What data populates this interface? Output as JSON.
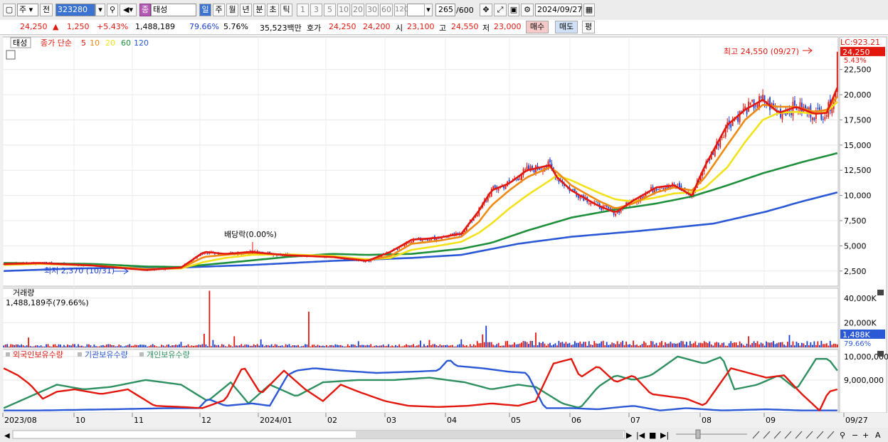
{
  "toolbar": {
    "type_stock": "주",
    "type_prev": "전",
    "code": "323280",
    "name_tag": "종",
    "name": "태성",
    "periods": [
      "일",
      "주",
      "월",
      "년",
      "분",
      "초",
      "틱"
    ],
    "minutes": [
      "1",
      "3",
      "5",
      "10",
      "20",
      "30",
      "60",
      "120"
    ],
    "count": "265",
    "count_total": "/600",
    "date": "2024/09/27"
  },
  "quote": {
    "price": "24,250",
    "arrow": "▲",
    "change": "1,250",
    "change_pct": "+5.43%",
    "volume": "1,488,189",
    "vol_ratio": "79.66%",
    "turnover": "5.76%",
    "amount": "35,523백만",
    "bid_label": "호가",
    "ask": "24,250",
    "bid": "24,200",
    "open_label": "시",
    "open": "23,100",
    "high_label": "고",
    "high": "24,550",
    "low_label": "저",
    "low": "23,000",
    "buy": "매수",
    "sell": "매도",
    "avg": "평"
  },
  "colors": {
    "up": "#e2180f",
    "down": "#1a3fd0",
    "ma5": "#e2180f",
    "ma10": "#ef8a12",
    "ma20": "#f2e21a",
    "ma60": "#1e8f3a",
    "ma120": "#2b59d6",
    "foreign": "#e2180f",
    "institution": "#2b59d6",
    "individual": "#2e9060"
  },
  "chart_data": [
    {
      "type": "candlestick",
      "panel": "price",
      "stock_label": "태성",
      "legend": {
        "ma_label": "종가 단순",
        "periods": [
          "5",
          "10",
          "20",
          "60",
          "120"
        ]
      },
      "y_ticks": [
        "2,500",
        "5,000",
        "7,500",
        "10,000",
        "12,500",
        "15,000",
        "17,500",
        "20,000",
        "22,500"
      ],
      "x_ticks": [
        "2023/08",
        "10",
        "11",
        "12",
        "2024/01",
        "02",
        "03",
        "04",
        "05",
        "06",
        "07",
        "08",
        "09",
        "09/27"
      ],
      "ylim": [
        1000,
        25300
      ],
      "current": "24,250",
      "current_pct": "5.43%",
      "lc": "LC:923.21",
      "annotations": {
        "high": "최고 24,550 (09/27)",
        "low": "최저 2,370 (10/31)",
        "dividend": "배당락(0.00%)"
      },
      "ma_knots": {
        "ma5": [
          [
            0,
            3200
          ],
          [
            20,
            3300
          ],
          [
            50,
            3050
          ],
          [
            80,
            2600
          ],
          [
            100,
            2850
          ],
          [
            113,
            4400
          ],
          [
            125,
            4200
          ],
          [
            140,
            4400
          ],
          [
            160,
            4050
          ],
          [
            185,
            3900
          ],
          [
            205,
            3500
          ],
          [
            218,
            4400
          ],
          [
            230,
            5600
          ],
          [
            245,
            5800
          ],
          [
            258,
            6200
          ],
          [
            268,
            8500
          ],
          [
            275,
            10500
          ],
          [
            285,
            11200
          ],
          [
            295,
            12500
          ],
          [
            308,
            13000
          ],
          [
            312,
            11800
          ],
          [
            320,
            10500
          ],
          [
            335,
            9000
          ],
          [
            345,
            8300
          ],
          [
            355,
            9500
          ],
          [
            368,
            10800
          ],
          [
            378,
            11000
          ],
          [
            388,
            10000
          ],
          [
            395,
            12800
          ],
          [
            408,
            17000
          ],
          [
            418,
            18500
          ],
          [
            428,
            19500
          ],
          [
            437,
            18200
          ],
          [
            447,
            18800
          ],
          [
            457,
            18100
          ],
          [
            464,
            18200
          ],
          [
            470,
            20700
          ]
        ],
        "ma10": [
          [
            0,
            3150
          ],
          [
            20,
            3250
          ],
          [
            50,
            3050
          ],
          [
            80,
            2650
          ],
          [
            100,
            2800
          ],
          [
            113,
            3900
          ],
          [
            125,
            4100
          ],
          [
            140,
            4300
          ],
          [
            160,
            4100
          ],
          [
            185,
            3900
          ],
          [
            205,
            3550
          ],
          [
            218,
            4000
          ],
          [
            230,
            5200
          ],
          [
            245,
            5500
          ],
          [
            258,
            5900
          ],
          [
            268,
            7400
          ],
          [
            275,
            9000
          ],
          [
            285,
            10500
          ],
          [
            295,
            11800
          ],
          [
            308,
            12800
          ],
          [
            312,
            12300
          ],
          [
            320,
            11000
          ],
          [
            335,
            9500
          ],
          [
            345,
            8700
          ],
          [
            355,
            9200
          ],
          [
            368,
            10300
          ],
          [
            378,
            10800
          ],
          [
            388,
            10500
          ],
          [
            395,
            11700
          ],
          [
            408,
            15000
          ],
          [
            418,
            17500
          ],
          [
            428,
            19000
          ],
          [
            437,
            18800
          ],
          [
            447,
            18800
          ],
          [
            457,
            18300
          ],
          [
            464,
            18500
          ],
          [
            470,
            19800
          ]
        ],
        "ma20": [
          [
            0,
            3100
          ],
          [
            20,
            3200
          ],
          [
            50,
            3050
          ],
          [
            80,
            2700
          ],
          [
            100,
            2750
          ],
          [
            113,
            3400
          ],
          [
            125,
            3800
          ],
          [
            140,
            4100
          ],
          [
            160,
            4150
          ],
          [
            185,
            4000
          ],
          [
            205,
            3650
          ],
          [
            218,
            3800
          ],
          [
            230,
            4600
          ],
          [
            245,
            5000
          ],
          [
            258,
            5400
          ],
          [
            268,
            6300
          ],
          [
            275,
            7200
          ],
          [
            285,
            8700
          ],
          [
            295,
            10000
          ],
          [
            308,
            11500
          ],
          [
            312,
            12000
          ],
          [
            320,
            11500
          ],
          [
            335,
            10300
          ],
          [
            345,
            9600
          ],
          [
            355,
            9400
          ],
          [
            368,
            9800
          ],
          [
            378,
            10200
          ],
          [
            388,
            10300
          ],
          [
            395,
            10700
          ],
          [
            408,
            12800
          ],
          [
            418,
            15300
          ],
          [
            428,
            17500
          ],
          [
            437,
            18200
          ],
          [
            447,
            18300
          ],
          [
            457,
            18100
          ],
          [
            464,
            18300
          ],
          [
            470,
            19300
          ]
        ],
        "ma60": [
          [
            0,
            3300
          ],
          [
            50,
            3200
          ],
          [
            80,
            2950
          ],
          [
            100,
            2900
          ],
          [
            125,
            3300
          ],
          [
            160,
            3900
          ],
          [
            185,
            4200
          ],
          [
            205,
            4100
          ],
          [
            230,
            4200
          ],
          [
            258,
            4700
          ],
          [
            275,
            5300
          ],
          [
            295,
            6500
          ],
          [
            320,
            7800
          ],
          [
            345,
            8600
          ],
          [
            368,
            9200
          ],
          [
            388,
            9900
          ],
          [
            408,
            11000
          ],
          [
            428,
            12200
          ],
          [
            450,
            13300
          ],
          [
            470,
            14200
          ]
        ],
        "ma120": [
          [
            0,
            2500
          ],
          [
            40,
            2750
          ],
          [
            80,
            2850
          ],
          [
            100,
            2850
          ],
          [
            140,
            3100
          ],
          [
            185,
            3500
          ],
          [
            230,
            3800
          ],
          [
            258,
            4100
          ],
          [
            290,
            5200
          ],
          [
            320,
            5900
          ],
          [
            360,
            6500
          ],
          [
            400,
            7200
          ],
          [
            430,
            8400
          ],
          [
            450,
            9400
          ],
          [
            470,
            10300
          ]
        ]
      }
    },
    {
      "type": "bar",
      "panel": "volume",
      "title": "거래량",
      "summary": "1,488,189주(79.66%)",
      "y_ticks": [
        "40,000K",
        "20,000K"
      ],
      "current": "1,488K",
      "current_pct": "79.66%",
      "ylim": [
        0,
        48000
      ],
      "spikes_thousands": {
        "14": 8000,
        "100": 4500,
        "113": 11000,
        "116": 46000,
        "118": 6000,
        "130": 9000,
        "145": 6500,
        "172": 29000,
        "200": 5000,
        "235": 5500,
        "240": 6000,
        "258": 6500,
        "265": 2500,
        "270": 10500,
        "272": 17500,
        "283": 5000,
        "288": 4000,
        "300": 12000,
        "315": 4500,
        "330": 5000,
        "355": 5500,
        "395": 5000,
        "410": 5000,
        "420": 9000,
        "443": 10000,
        "468": 3000
      },
      "base_thousands": 1800
    },
    {
      "type": "line",
      "panel": "holdings",
      "series_names": [
        "외국인보유수량",
        "기관보유수량",
        "개인보유수량"
      ],
      "y_ticks": [
        "10,000,000",
        "9,000,000"
      ],
      "ylim": [
        7600000,
        10300000
      ],
      "series_knots": {
        "foreign": [
          [
            0,
            9500000
          ],
          [
            8,
            9200000
          ],
          [
            15,
            8800000
          ],
          [
            22,
            8200000
          ],
          [
            30,
            8500000
          ],
          [
            40,
            8600000
          ],
          [
            55,
            8400000
          ],
          [
            70,
            8600000
          ],
          [
            85,
            7900000
          ],
          [
            100,
            7850000
          ],
          [
            112,
            7800000
          ],
          [
            125,
            8150000
          ],
          [
            135,
            9600000
          ],
          [
            145,
            8400000
          ],
          [
            158,
            9400000
          ],
          [
            170,
            8600000
          ],
          [
            180,
            8100000
          ],
          [
            190,
            8800000
          ],
          [
            200,
            8500000
          ],
          [
            215,
            8100000
          ],
          [
            228,
            7900000
          ],
          [
            245,
            7850000
          ],
          [
            262,
            7900000
          ],
          [
            275,
            8000000
          ],
          [
            290,
            7900000
          ],
          [
            300,
            8100000
          ],
          [
            310,
            9700000
          ],
          [
            320,
            9900000
          ],
          [
            325,
            9100000
          ],
          [
            335,
            9600000
          ],
          [
            345,
            8900000
          ],
          [
            355,
            9200000
          ],
          [
            365,
            8400000
          ],
          [
            375,
            8300000
          ],
          [
            385,
            8200000
          ],
          [
            395,
            7900000
          ],
          [
            410,
            9500000
          ],
          [
            420,
            9300000
          ],
          [
            430,
            9100000
          ],
          [
            440,
            9200000
          ],
          [
            450,
            8400000
          ],
          [
            460,
            7700000
          ],
          [
            465,
            8500000
          ],
          [
            470,
            8600000
          ]
        ],
        "institution": [
          [
            0,
            7700000
          ],
          [
            20,
            7700000
          ],
          [
            60,
            7750000
          ],
          [
            95,
            7800000
          ],
          [
            110,
            7800000
          ],
          [
            115,
            8200000
          ],
          [
            125,
            7900000
          ],
          [
            140,
            8000000
          ],
          [
            150,
            7900000
          ],
          [
            160,
            9200000
          ],
          [
            165,
            9400000
          ],
          [
            175,
            9500000
          ],
          [
            190,
            9400000
          ],
          [
            210,
            9300000
          ],
          [
            230,
            9350000
          ],
          [
            245,
            9400000
          ],
          [
            251,
            9900000
          ],
          [
            255,
            9600000
          ],
          [
            270,
            9500000
          ],
          [
            285,
            9350000
          ],
          [
            295,
            9300000
          ],
          [
            305,
            7800000
          ],
          [
            320,
            7800000
          ],
          [
            335,
            7750000
          ],
          [
            355,
            7900000
          ],
          [
            370,
            7700000
          ],
          [
            385,
            7800000
          ],
          [
            405,
            7700000
          ],
          [
            430,
            7750000
          ],
          [
            450,
            7700000
          ],
          [
            470,
            7700000
          ]
        ],
        "individual": [
          [
            0,
            7800000
          ],
          [
            15,
            8300000
          ],
          [
            30,
            8800000
          ],
          [
            45,
            8600000
          ],
          [
            60,
            8700000
          ],
          [
            80,
            9000000
          ],
          [
            100,
            8800000
          ],
          [
            115,
            8100000
          ],
          [
            128,
            8900000
          ],
          [
            138,
            8000000
          ],
          [
            150,
            8800000
          ],
          [
            165,
            8300000
          ],
          [
            180,
            8900000
          ],
          [
            200,
            9000000
          ],
          [
            220,
            9000000
          ],
          [
            240,
            9100000
          ],
          [
            260,
            8900000
          ],
          [
            275,
            8600000
          ],
          [
            290,
            8800000
          ],
          [
            300,
            8700000
          ],
          [
            315,
            8000000
          ],
          [
            325,
            7800000
          ],
          [
            335,
            8700000
          ],
          [
            345,
            9200000
          ],
          [
            355,
            9000000
          ],
          [
            365,
            9200000
          ],
          [
            380,
            10000000
          ],
          [
            395,
            9700000
          ],
          [
            405,
            10000000
          ],
          [
            412,
            8600000
          ],
          [
            425,
            8800000
          ],
          [
            437,
            9200000
          ],
          [
            447,
            8600000
          ],
          [
            458,
            9900000
          ],
          [
            465,
            9900000
          ],
          [
            470,
            9400000
          ]
        ]
      }
    }
  ]
}
